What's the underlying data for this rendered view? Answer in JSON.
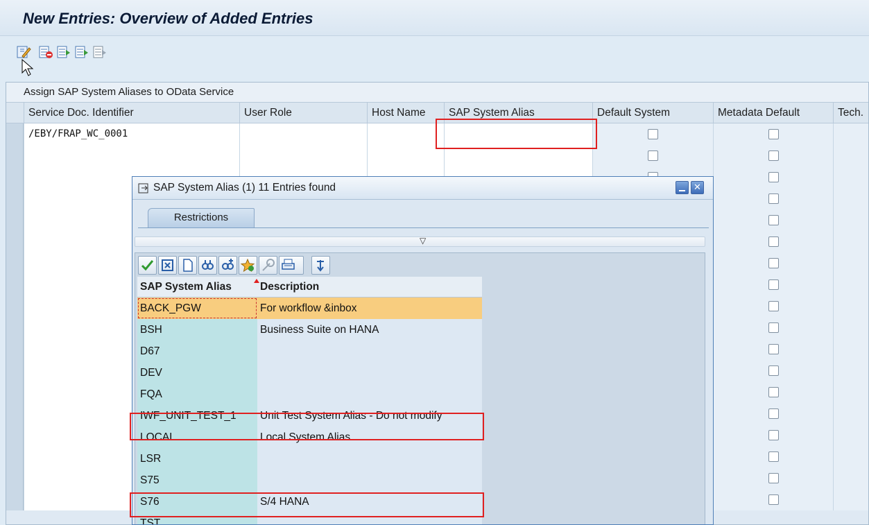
{
  "window": {
    "title": "New Entries: Overview of Added Entries"
  },
  "toolbar": {
    "buttons": [
      {
        "name": "display-change-icon"
      },
      {
        "name": "delete-row-icon"
      },
      {
        "name": "select-all-icon"
      },
      {
        "name": "select-block-icon"
      },
      {
        "name": "deselect-all-icon"
      }
    ]
  },
  "table": {
    "caption": "Assign SAP System Aliases to OData Service",
    "columns": [
      "Service Doc. Identifier",
      "User Role",
      "Host Name",
      "SAP System Alias",
      "Default System",
      "Metadata Default",
      "Tech."
    ],
    "first_row_identifier": "/EBY/FRAP_WC_0001",
    "row_count": 18
  },
  "popup": {
    "title": "SAP System Alias (1)   11 Entries found",
    "tab": "Restrictions",
    "toolbar_icons": [
      "check-icon",
      "cancel-icon",
      "new-page-icon",
      "find-icon",
      "find-next-icon",
      "favorites-icon",
      "help-icon",
      "print-icon",
      "sort-icon"
    ],
    "headers": {
      "alias": "SAP System Alias",
      "description": "Description"
    },
    "rows": [
      {
        "alias": "BACK_PGW",
        "description": "For workflow &inbox",
        "selected": true
      },
      {
        "alias": "BSH",
        "description": "Business Suite on HANA"
      },
      {
        "alias": "D67",
        "description": ""
      },
      {
        "alias": "DEV",
        "description": ""
      },
      {
        "alias": "FQA",
        "description": ""
      },
      {
        "alias": "IWF_UNIT_TEST_1",
        "description": "Unit Test System Alias - Do not modify"
      },
      {
        "alias": "LOCAL",
        "description": "Local System Alias"
      },
      {
        "alias": "LSR",
        "description": ""
      },
      {
        "alias": "S75",
        "description": ""
      },
      {
        "alias": "S76",
        "description": "S/4 HANA"
      },
      {
        "alias": "TST",
        "description": ""
      }
    ]
  },
  "colors": {
    "highlight": "#f8cd7f",
    "annotation": "#e02020",
    "alias_column": "#bde3e6"
  }
}
